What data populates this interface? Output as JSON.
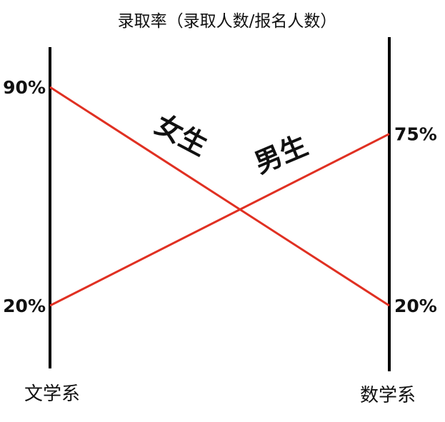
{
  "chart_data": {
    "type": "line",
    "title": "录取率（录取人数/报名人数）",
    "categories": [
      "文学系",
      "数学系"
    ],
    "series": [
      {
        "name": "女生",
        "values": [
          90,
          20
        ],
        "value_labels": [
          "90%",
          "20%"
        ],
        "color": "#e03022"
      },
      {
        "name": "男生",
        "values": [
          20,
          75
        ],
        "value_labels": [
          "20%",
          "75%"
        ],
        "color": "#e03022"
      }
    ],
    "grid": false
  }
}
